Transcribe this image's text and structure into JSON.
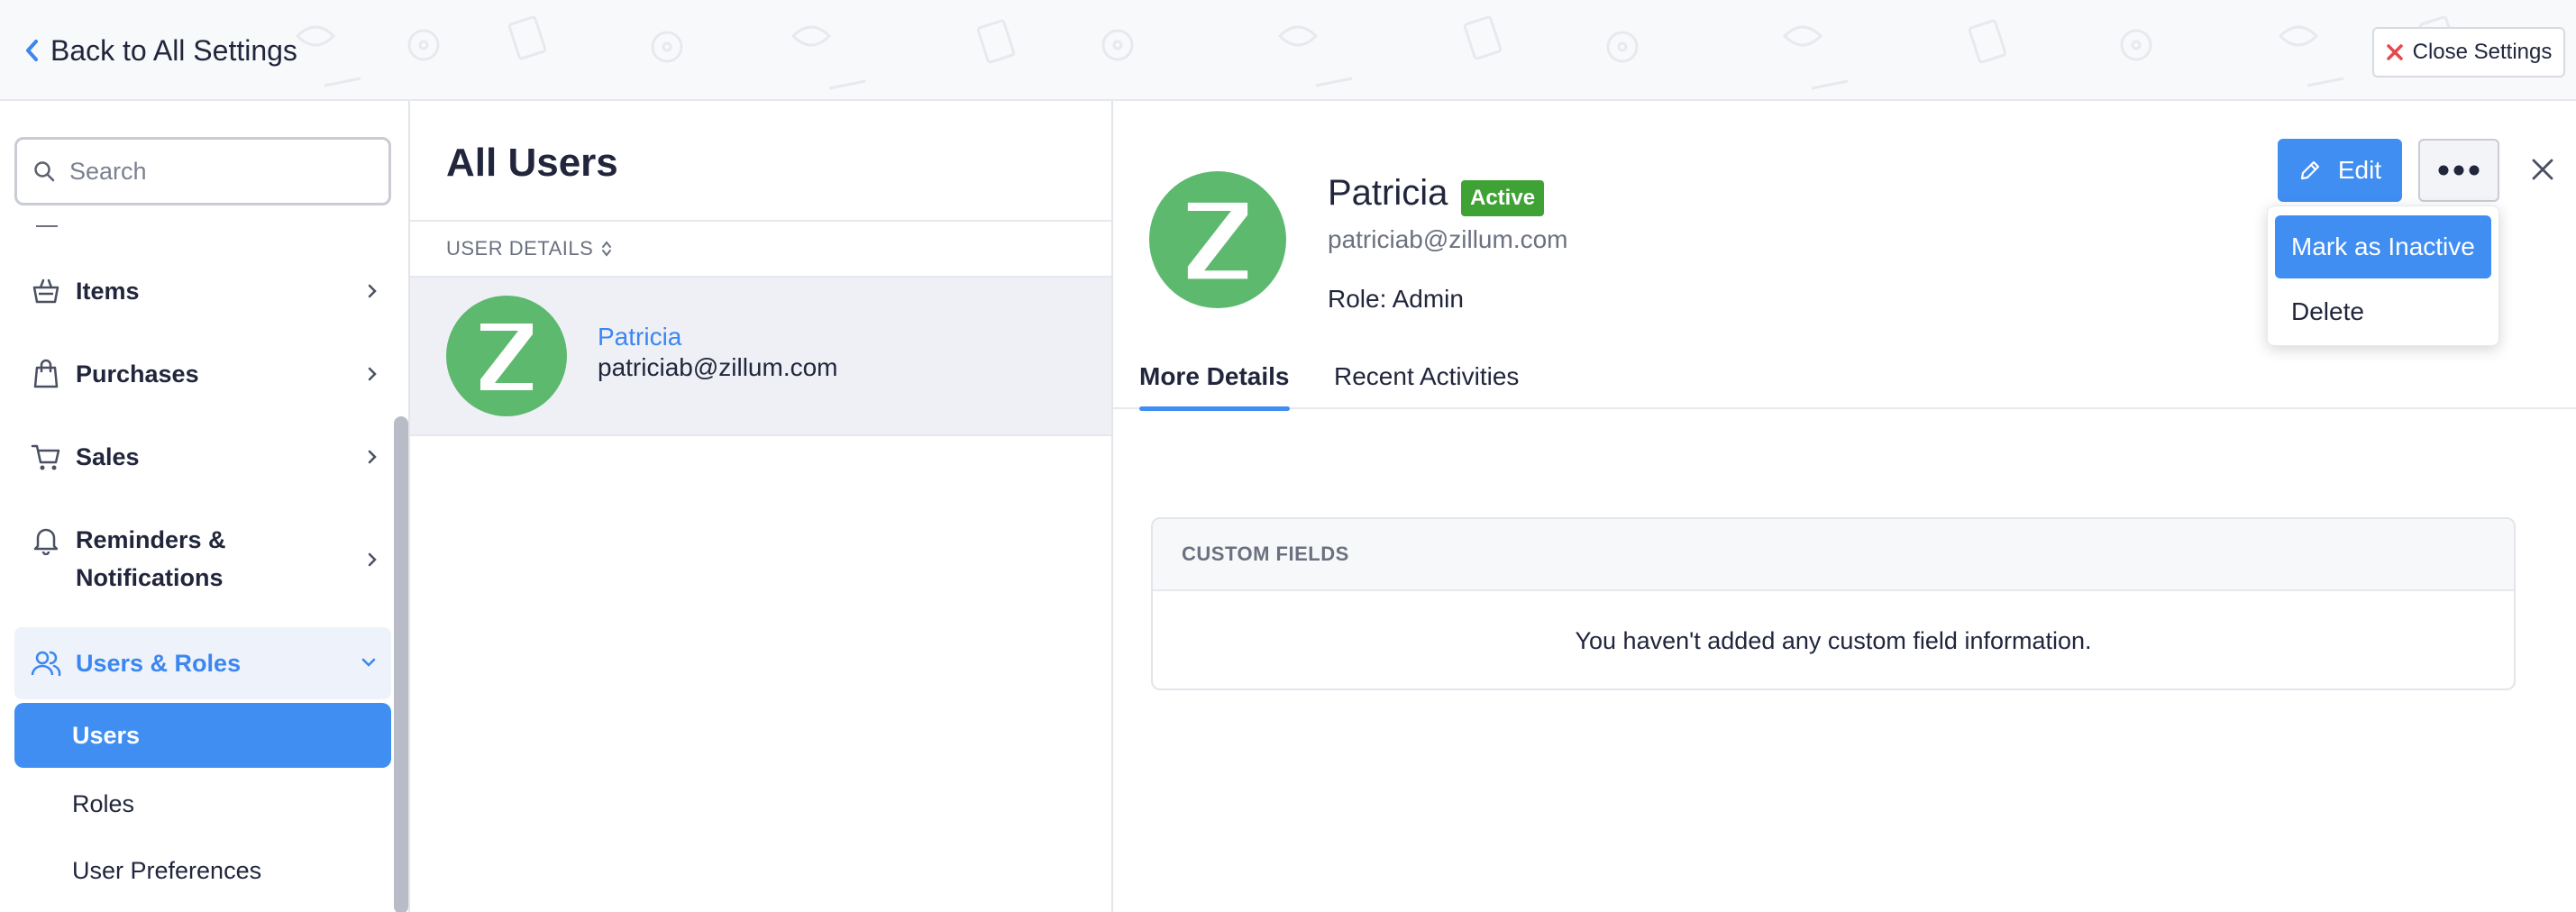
{
  "header": {
    "back_label": "Back to All Settings",
    "close_label": "Close Settings"
  },
  "sidebar": {
    "search_placeholder": "Search",
    "items": [
      {
        "label": "Items",
        "icon": "basket-icon"
      },
      {
        "label": "Purchases",
        "icon": "shopping-bag-icon"
      },
      {
        "label": "Sales",
        "icon": "cart-icon"
      },
      {
        "label_line1": "Reminders &",
        "label_line2": "Notifications",
        "icon": "bell-icon"
      },
      {
        "label": "Users & Roles",
        "icon": "users-icon",
        "expanded": true
      }
    ],
    "sub_items": [
      {
        "label": "Users",
        "selected": true
      },
      {
        "label": "Roles"
      },
      {
        "label": "User Preferences"
      }
    ]
  },
  "list": {
    "title": "All Users",
    "column_header": "USER DETAILS",
    "users": [
      {
        "initial": "Z",
        "name": "Patricia",
        "email": "patriciab@zillum.com"
      }
    ]
  },
  "detail": {
    "initial": "Z",
    "name": "Patricia",
    "status": "Active",
    "email": "patriciab@zillum.com",
    "role": "Role: Admin",
    "edit_label": "Edit",
    "menu": {
      "mark_inactive": "Mark as Inactive",
      "delete": "Delete"
    },
    "tabs": [
      "More Details",
      "Recent Activities"
    ],
    "custom_fields": {
      "title": "CUSTOM FIELDS",
      "empty_text": "You haven't added any custom field information."
    }
  },
  "colors": {
    "accent": "#408ef2",
    "avatar": "#5cb96e",
    "active_badge": "#3fa234",
    "close_red": "#e5484d"
  }
}
